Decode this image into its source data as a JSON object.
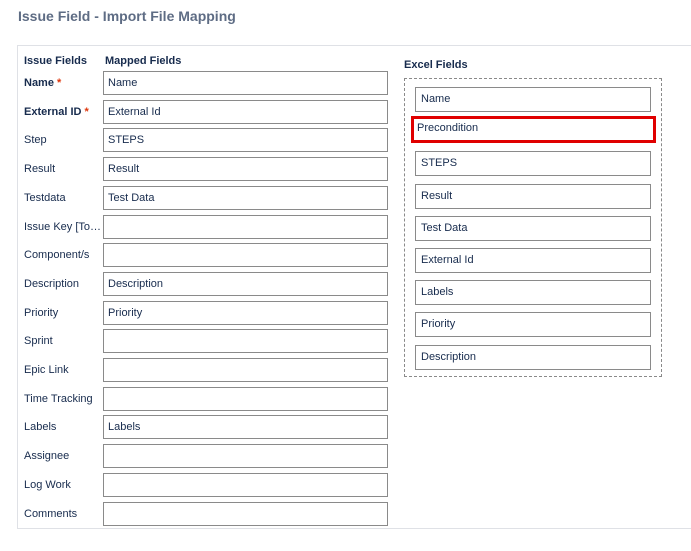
{
  "page": {
    "title": "Issue Field - Import File Mapping"
  },
  "headers": {
    "issue_fields": "Issue Fields",
    "mapped_fields": "Mapped Fields",
    "excel_fields": "Excel Fields"
  },
  "required_marker": "*",
  "rows": [
    {
      "label": "Name",
      "required": true,
      "value": "Name"
    },
    {
      "label": "External ID",
      "required": true,
      "value": "External Id"
    },
    {
      "label": "Step",
      "required": false,
      "value": "STEPS"
    },
    {
      "label": "Result",
      "required": false,
      "value": "Result"
    },
    {
      "label": "Testdata",
      "required": false,
      "value": "Test Data"
    },
    {
      "label": "Issue Key [To a...",
      "required": false,
      "value": ""
    },
    {
      "label": "Component/s",
      "required": false,
      "value": ""
    },
    {
      "label": "Description",
      "required": false,
      "value": "Description"
    },
    {
      "label": "Priority",
      "required": false,
      "value": "Priority"
    },
    {
      "label": "Sprint",
      "required": false,
      "value": ""
    },
    {
      "label": "Epic Link",
      "required": false,
      "value": ""
    },
    {
      "label": "Time Tracking",
      "required": false,
      "value": ""
    },
    {
      "label": "Labels",
      "required": false,
      "value": "Labels"
    },
    {
      "label": "Assignee",
      "required": false,
      "value": ""
    },
    {
      "label": "Log Work",
      "required": false,
      "value": ""
    },
    {
      "label": "Comments",
      "required": false,
      "value": ""
    }
  ],
  "excel_fields": [
    {
      "label": "Name",
      "highlighted": false
    },
    {
      "label": "Precondition",
      "highlighted": true
    },
    {
      "label": "STEPS",
      "highlighted": false
    },
    {
      "label": "Result",
      "highlighted": false
    },
    {
      "label": "Test Data",
      "highlighted": false
    },
    {
      "label": "External Id",
      "highlighted": false
    },
    {
      "label": "Labels",
      "highlighted": false
    },
    {
      "label": "Priority",
      "highlighted": false
    },
    {
      "label": "Description",
      "highlighted": false
    }
  ],
  "colors": {
    "required": "#de350b",
    "highlight": "#e00000",
    "title": "#5e6c84"
  }
}
